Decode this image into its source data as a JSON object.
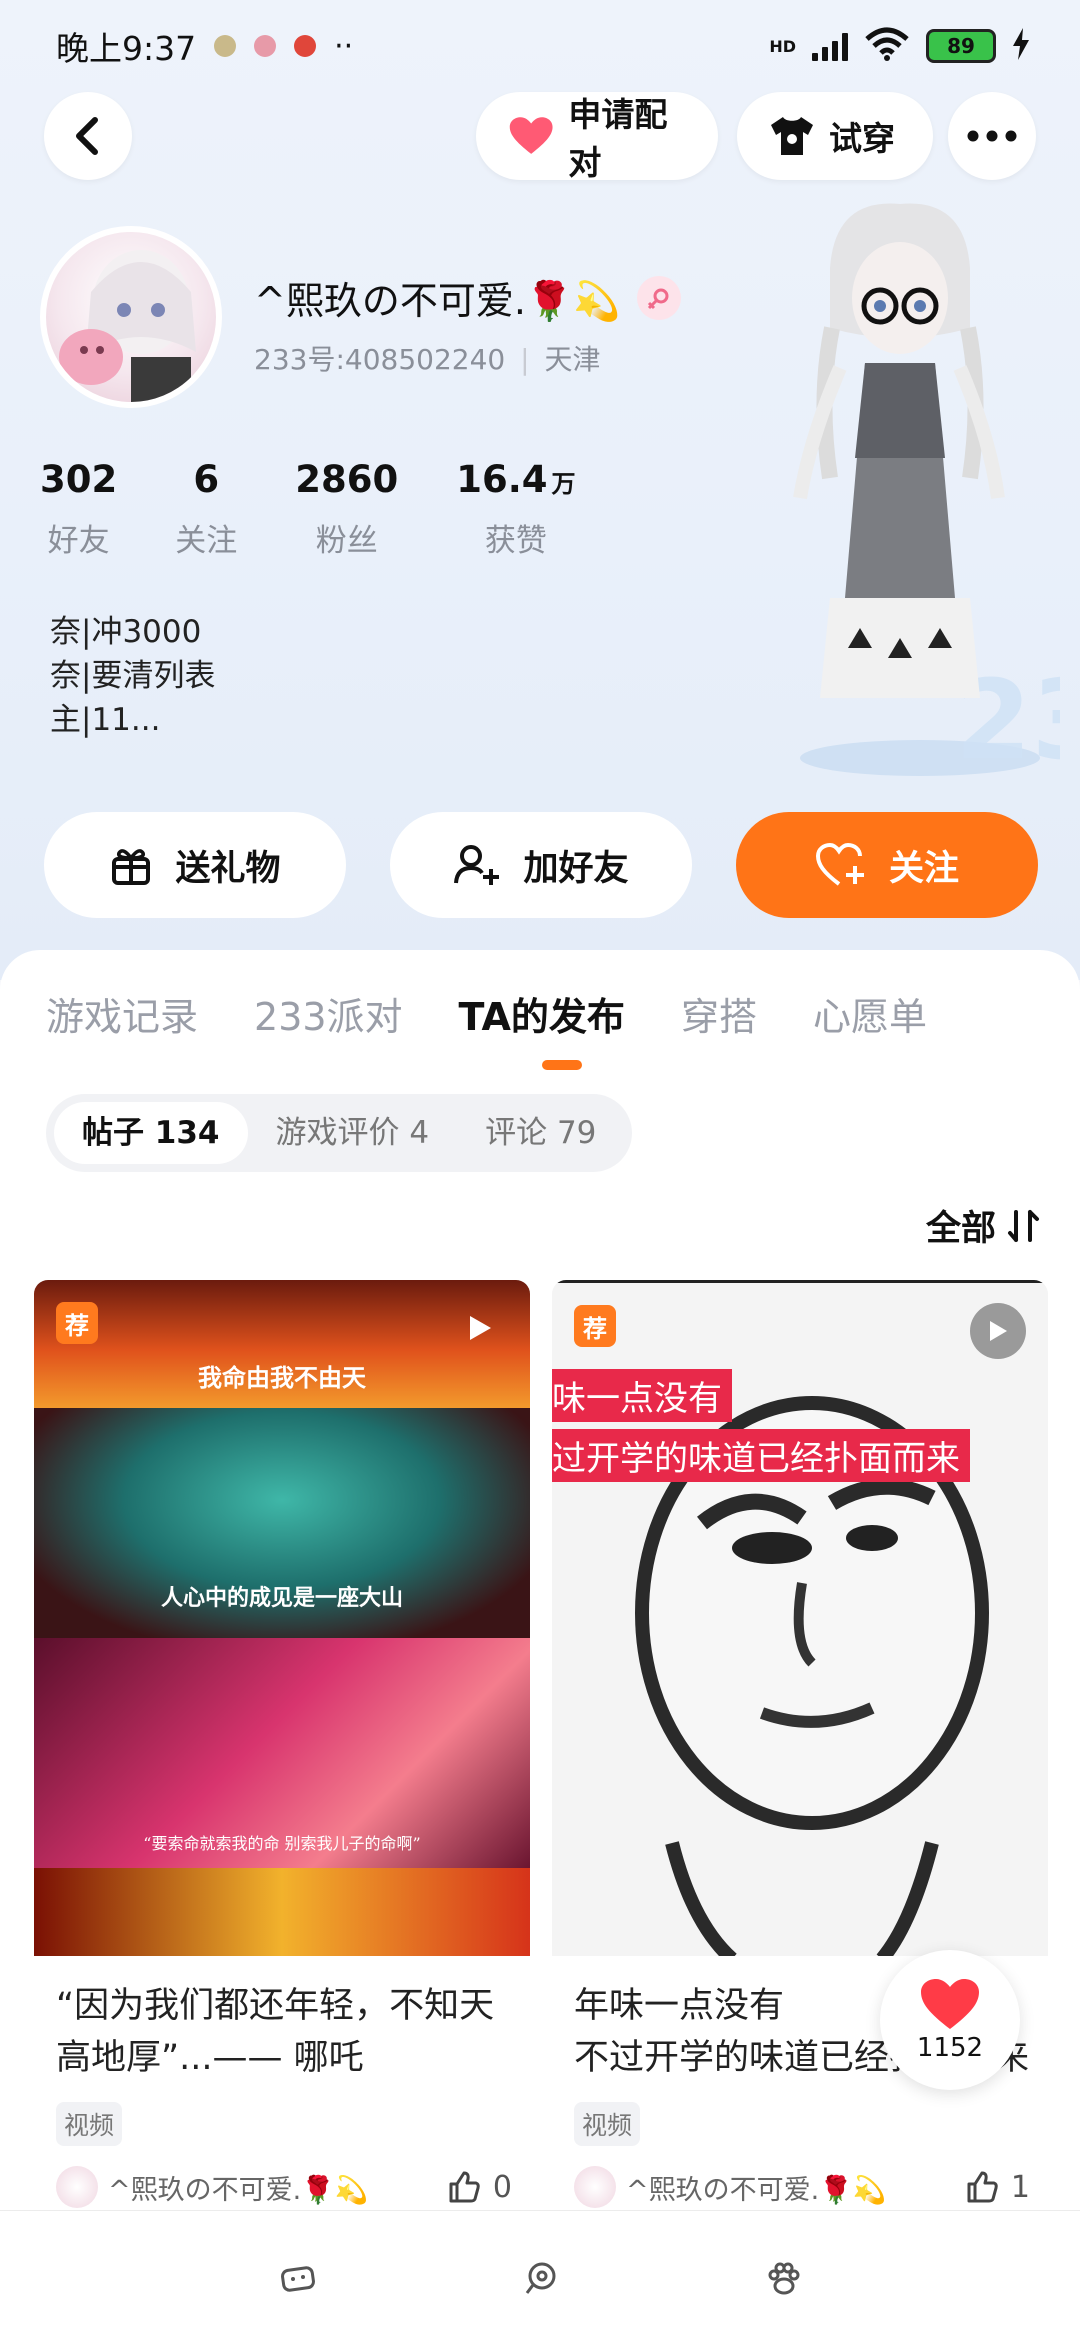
{
  "status_bar": {
    "time": "晚上9:37",
    "network": "HD",
    "battery": "89"
  },
  "top_bar": {
    "pair_label": "申请配对",
    "tryon_label": "试穿"
  },
  "profile": {
    "username": "^熙玖の不可爱.🌹💫",
    "id_text": "233号:408502240",
    "location": "天津",
    "stats": [
      {
        "num": "302",
        "unit": "",
        "label": "好友"
      },
      {
        "num": "6",
        "unit": "",
        "label": "关注"
      },
      {
        "num": "2860",
        "unit": "",
        "label": "粉丝"
      },
      {
        "num": "16.4",
        "unit": "万",
        "label": "获赞"
      }
    ],
    "bio": [
      "奈|冲3000",
      "奈|要清列表",
      "主|11..."
    ]
  },
  "actions": {
    "gift": "送礼物",
    "add_friend": "加好友",
    "follow": "关注"
  },
  "tabs": [
    "游戏记录",
    "233派对",
    "TA的发布",
    "穿搭",
    "心愿单"
  ],
  "active_tab": "TA的发布",
  "segments": [
    "帖子 134",
    "游戏评价 4",
    "评论 79"
  ],
  "sort_label": "全部",
  "posts": [
    {
      "badge": "荐",
      "overlay_texts": [
        "我命由我不由天",
        "人心中的成见是一座大山",
        "“要索命就索我的命 别索我儿子的命啊”"
      ],
      "title": "“因为我们都还年轻，不知天高地厚”...—— 哪吒",
      "tag": "视频",
      "author": "^熙玖の不可爱.🌹💫",
      "likes": "0"
    },
    {
      "badge": "荐",
      "overlay_texts": [
        "味一点没有",
        "过开学的味道已经扑面而来"
      ],
      "title": "年味一点没有\n不过开学的味道已经扑面而来",
      "tag": "视频",
      "author": "^熙玖の不可爱.🌹💫",
      "likes": "1"
    }
  ],
  "heart_count": "1152",
  "colors": {
    "accent": "#ff7417",
    "heart": "#ff3b47"
  },
  "icons": [
    "back-icon",
    "heart-icon",
    "tshirt-icon",
    "more-icon",
    "gift-icon",
    "add-user-icon",
    "heart-plus-icon",
    "sort-icon",
    "play-icon",
    "thumb-up-icon",
    "game-icon",
    "chat-icon",
    "paw-icon"
  ]
}
